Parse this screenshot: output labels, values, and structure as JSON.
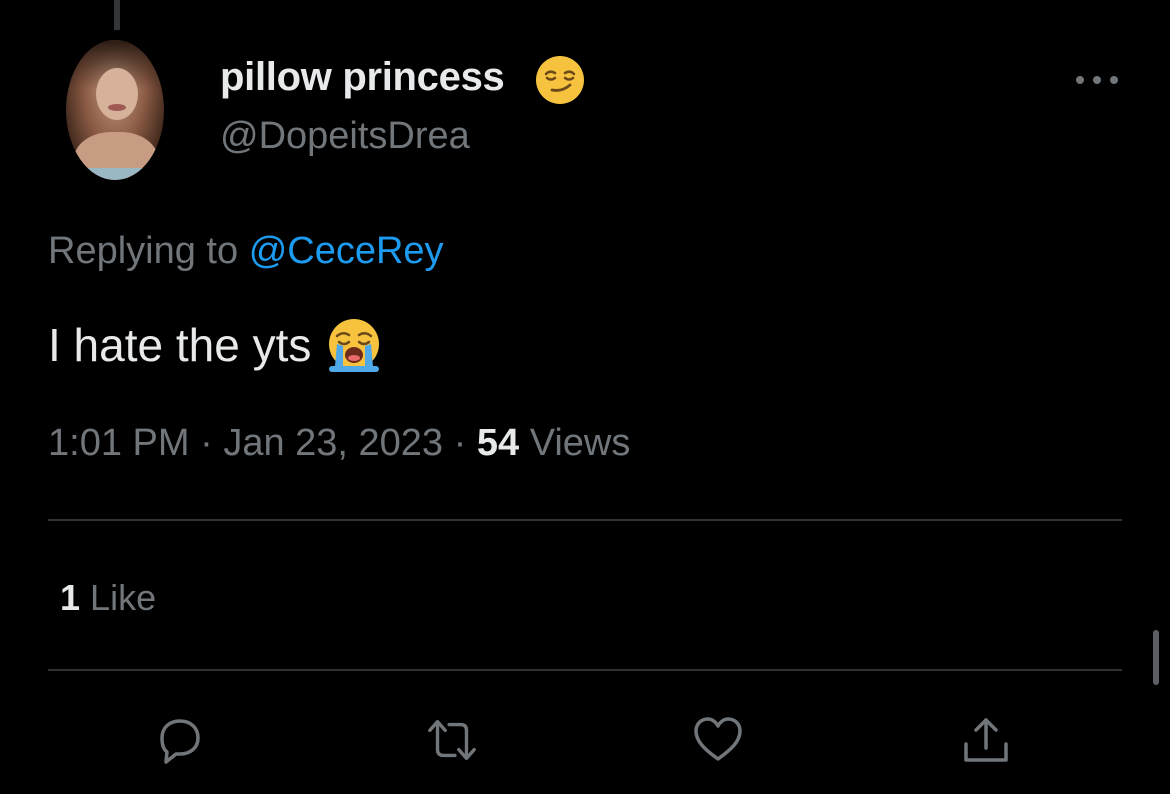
{
  "tweet": {
    "author": {
      "display_name": "pillow princess",
      "name_emoji": "smirking-face-emoji",
      "handle": "@DopeitsDrea"
    },
    "replying_to_label": "Replying to",
    "replying_to_handle": "@CeceRey",
    "text": "I hate the yts",
    "text_emoji": "loudly-crying-face-emoji",
    "time": "1:01 PM",
    "separator": "·",
    "date": "Jan 23, 2023",
    "views_count": "54",
    "views_label": "Views",
    "likes_count": "1",
    "likes_label": "Like"
  },
  "actions": [
    {
      "name": "reply-icon"
    },
    {
      "name": "retweet-icon"
    },
    {
      "name": "like-icon"
    },
    {
      "name": "share-icon"
    }
  ],
  "colors": {
    "background": "#000000",
    "text_primary": "#e7e9ea",
    "text_secondary": "#71767b",
    "link": "#1d9bf0",
    "divider": "#2f3336"
  }
}
